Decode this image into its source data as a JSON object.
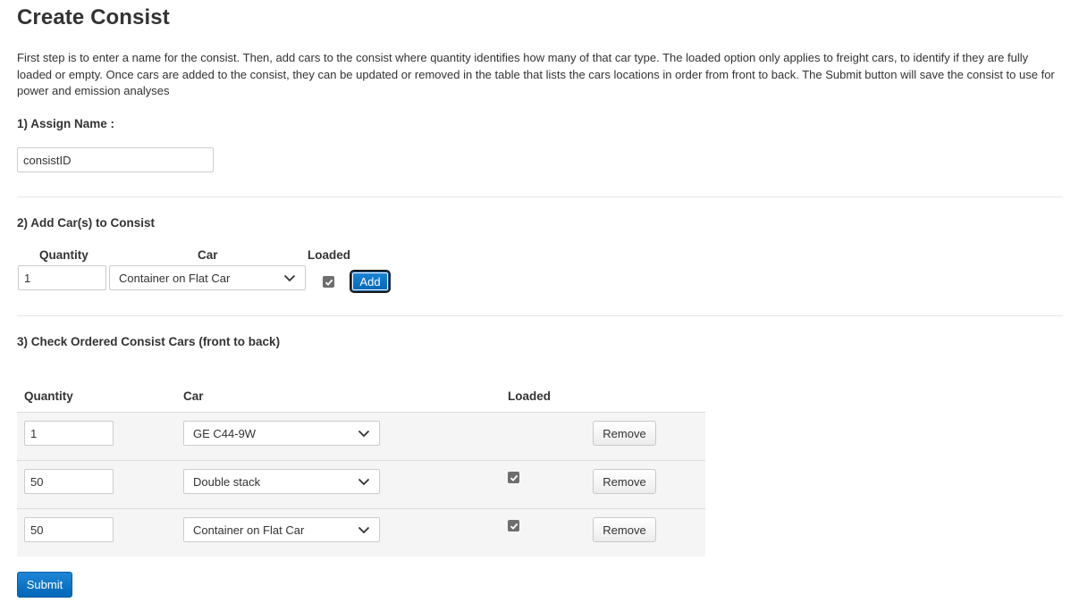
{
  "page": {
    "title": "Create Consist",
    "intro": "First step is to enter a name for the consist. Then, add cars to the consist where quantity identifies how many of that car type. The loaded option only applies to freight cars, to identify if they are fully loaded or empty. Once cars are added to the consist, they can be updated or removed in the table that lists the cars locations in order from front to back. The Submit button will save the consist to use for power and emission analyses"
  },
  "assign": {
    "title": "1) Assign Name :",
    "name_value": "consistID"
  },
  "add_cars": {
    "title": "2) Add Car(s) to Consist",
    "quantity_label": "Quantity",
    "car_label": "Car",
    "loaded_label": "Loaded",
    "quantity_value": "1",
    "car_value": "Container on Flat Car",
    "loaded": true,
    "add_label": "Add"
  },
  "ordered": {
    "title": "3) Check Ordered Consist Cars (front to back)",
    "headers": {
      "quantity": "Quantity",
      "car": "Car",
      "loaded": "Loaded"
    },
    "remove_label": "Remove",
    "rows": [
      {
        "quantity": "1",
        "car": "GE C44-9W",
        "loaded": null
      },
      {
        "quantity": "50",
        "car": "Double stack",
        "loaded": true
      },
      {
        "quantity": "50",
        "car": "Container on Flat Car",
        "loaded": true
      }
    ]
  },
  "submit_label": "Submit",
  "colors": {
    "primary_button": "#0067b8",
    "checkbox": "#6e6e6e",
    "row_background": "#f5f5f5",
    "text": "#333333"
  }
}
